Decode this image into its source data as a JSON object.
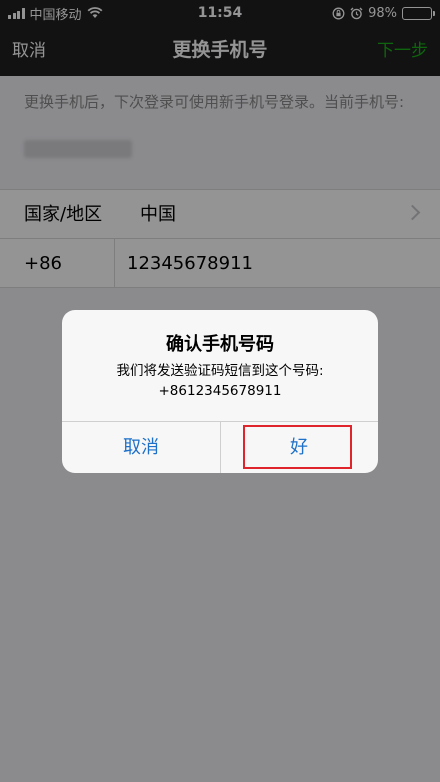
{
  "status_bar": {
    "carrier": "中国移动",
    "time": "11:54",
    "battery": "98%",
    "battery_level": 0.98,
    "icons": [
      "signal-icon",
      "wifi-icon",
      "orientation-lock-icon",
      "alarm-icon",
      "battery-icon"
    ]
  },
  "nav": {
    "cancel_label": "取消",
    "title": "更换手机号",
    "next_label": "下一步"
  },
  "intro": {
    "text": "更换手机后，下次登录可使用新手机号登录。当前手机号:"
  },
  "form": {
    "region_label": "国家/地区",
    "region_value": "中国",
    "country_code": "+86",
    "phone_value": "12345678911"
  },
  "dialog": {
    "title": "确认手机号码",
    "message_line1": "我们将发送验证码短信到这个号码:",
    "message_line2": "+8612345678911",
    "cancel_label": "取消",
    "ok_label": "好"
  },
  "colors": {
    "nav_background": "#1f1f22",
    "next_accent": "#1aad19",
    "dialog_button": "#1e70c8",
    "highlight": "#e0242c",
    "battery_fill": "#4cd964"
  }
}
